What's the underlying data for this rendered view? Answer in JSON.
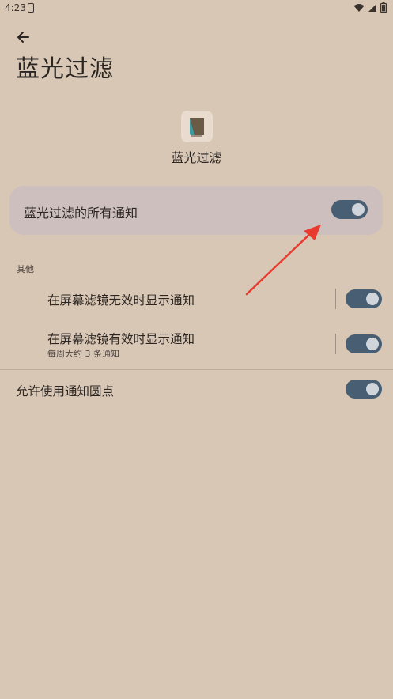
{
  "status_bar": {
    "time": "4:23"
  },
  "header": {
    "title": "蓝光过滤"
  },
  "app": {
    "name": "蓝光过滤",
    "icon": "app-icon"
  },
  "main_toggle": {
    "label": "蓝光过滤的所有通知",
    "enabled": true
  },
  "section": {
    "header": "其他",
    "items": [
      {
        "title": "在屏幕滤镜无效时显示通知",
        "subtitle": "",
        "enabled": true
      },
      {
        "title": "在屏幕滤镜有效时显示通知",
        "subtitle": "每周大约 3 条通知",
        "enabled": true
      }
    ]
  },
  "dot_setting": {
    "label": "允许使用通知圆点",
    "enabled": true
  },
  "colors": {
    "background": "#d9c7b6",
    "card": "#cdbfbd",
    "toggle_track": "#485e73",
    "annotation_arrow": "#e83a2f"
  }
}
